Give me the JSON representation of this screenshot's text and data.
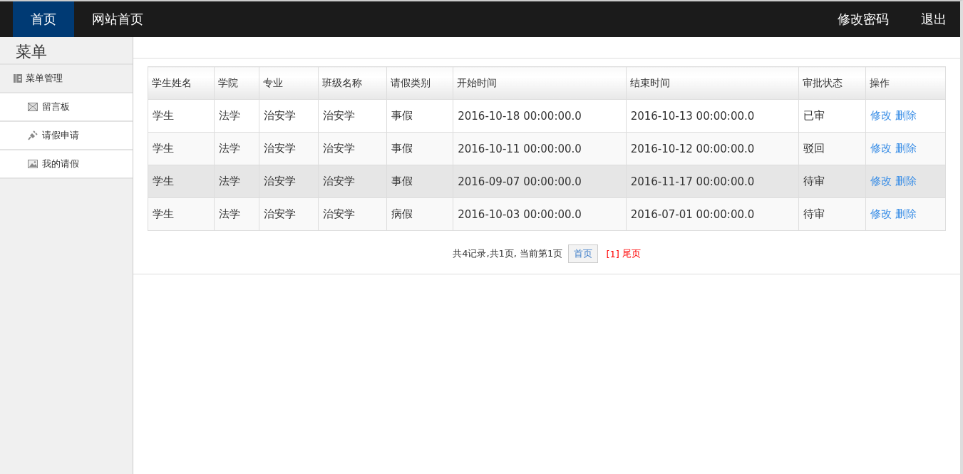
{
  "topbar": {
    "left": [
      {
        "label": "首页",
        "selected": true
      },
      {
        "label": "网站首页",
        "selected": false
      }
    ],
    "right": [
      {
        "label": "修改密码"
      },
      {
        "label": "退出"
      }
    ]
  },
  "sidebar": {
    "title": "菜单",
    "group": {
      "label": "菜单管理"
    },
    "items": [
      {
        "label": "留言板"
      },
      {
        "label": "请假申请"
      },
      {
        "label": "我的请假"
      }
    ]
  },
  "table": {
    "columns": [
      "学生姓名",
      "学院",
      "专业",
      "班级名称",
      "请假类别",
      "开始时间",
      "结束时间",
      "审批状态",
      "操作"
    ],
    "rows": [
      {
        "cells": [
          "学生",
          "法学",
          "治安学",
          "治安学",
          "事假",
          "2016-10-18 00:00:00.0",
          "2016-10-13 00:00:00.0",
          "已审"
        ],
        "actions": [
          "修改",
          "删除"
        ],
        "selected": false
      },
      {
        "cells": [
          "学生",
          "法学",
          "治安学",
          "治安学",
          "事假",
          "2016-10-11 00:00:00.0",
          "2016-10-12 00:00:00.0",
          "驳回"
        ],
        "actions": [
          "修改",
          "删除"
        ],
        "selected": false
      },
      {
        "cells": [
          "学生",
          "法学",
          "治安学",
          "治安学",
          "事假",
          "2016-09-07 00:00:00.0",
          "2016-11-17 00:00:00.0",
          "待审"
        ],
        "actions": [
          "修改",
          "删除"
        ],
        "selected": true
      },
      {
        "cells": [
          "学生",
          "法学",
          "治安学",
          "治安学",
          "病假",
          "2016-10-03 00:00:00.0",
          "2016-07-01 00:00:00.0",
          "待审"
        ],
        "actions": [
          "修改",
          "删除"
        ],
        "selected": false
      }
    ]
  },
  "pager": {
    "summary": "共4记录,共1页, 当前第1页",
    "first": "首页",
    "current": "[1]",
    "last": "尾页"
  }
}
